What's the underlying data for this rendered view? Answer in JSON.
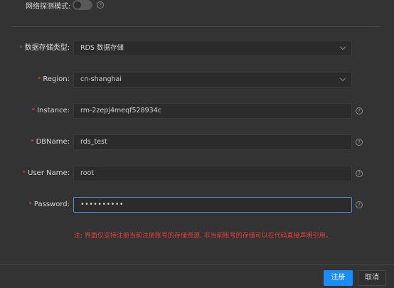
{
  "network_probe": {
    "label": "网络探测模式:",
    "toggle_on": false,
    "help": "?"
  },
  "form": {
    "storage_type": {
      "label": "数据存储类型:",
      "value": "RDS 数据存储"
    },
    "region": {
      "label": "Region:",
      "value": "cn-shanghai"
    },
    "instance": {
      "label": "Instance:",
      "value": "rm-2zepj4meqf528934c",
      "help": "?"
    },
    "dbname": {
      "label": "DBName:",
      "value": "rds_test",
      "help": "?"
    },
    "username": {
      "label": "User Name:",
      "value": "root",
      "help": "?"
    },
    "password": {
      "label": "Password:",
      "value": "••••••••••",
      "help": "?"
    }
  },
  "required_mark": "*",
  "notice": "注: 界面仅支持注册当前注册账号的存储资源. 非当前账号的存储可以在代码直接声明引用。",
  "buttons": {
    "register": "注册",
    "cancel": "取消"
  },
  "colors": {
    "primary": "#1a8cff",
    "required": "#e8453c",
    "notice": "#e0413d",
    "background": "#333333"
  }
}
